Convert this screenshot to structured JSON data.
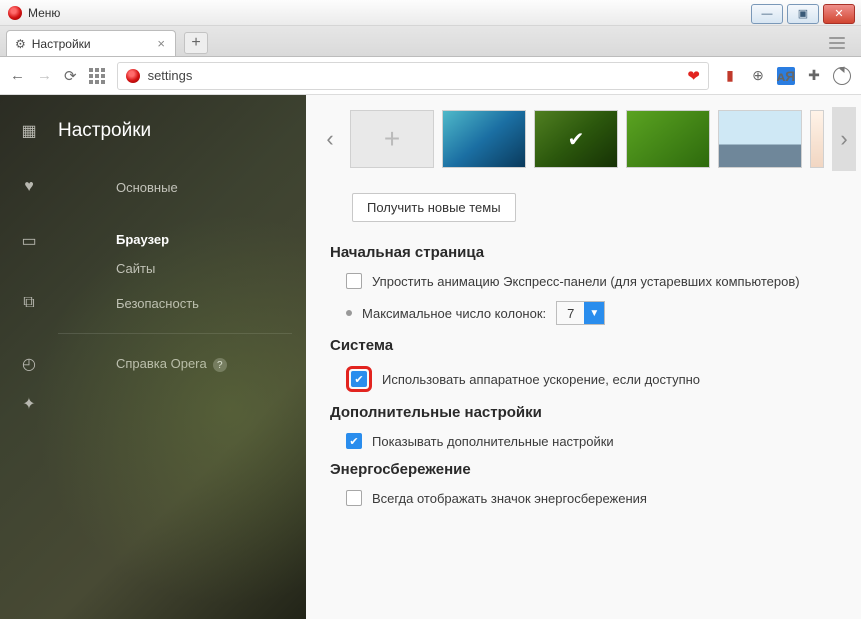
{
  "window": {
    "menu": "Меню"
  },
  "tab": {
    "title": "Настройки"
  },
  "url": {
    "value": "settings"
  },
  "sidebar": {
    "title": "Настройки",
    "items": [
      "Основные",
      "Браузер",
      "Сайты",
      "Безопасность"
    ],
    "help": "Справка Opera"
  },
  "themes": {
    "get_more": "Получить новые темы"
  },
  "startpage": {
    "heading": "Начальная страница",
    "simplify": "Упростить анимацию Экспресс-панели (для устаревших компьютеров)",
    "max_columns_label": "Максимальное число колонок:",
    "max_columns_value": "7"
  },
  "system": {
    "heading": "Система",
    "hw_accel": "Использовать аппаратное ускорение, если доступно"
  },
  "advanced": {
    "heading": "Дополнительные настройки",
    "show": "Показывать дополнительные настройки"
  },
  "power": {
    "heading": "Энергосбережение",
    "always_icon": "Всегда отображать значок энергосбережения"
  }
}
